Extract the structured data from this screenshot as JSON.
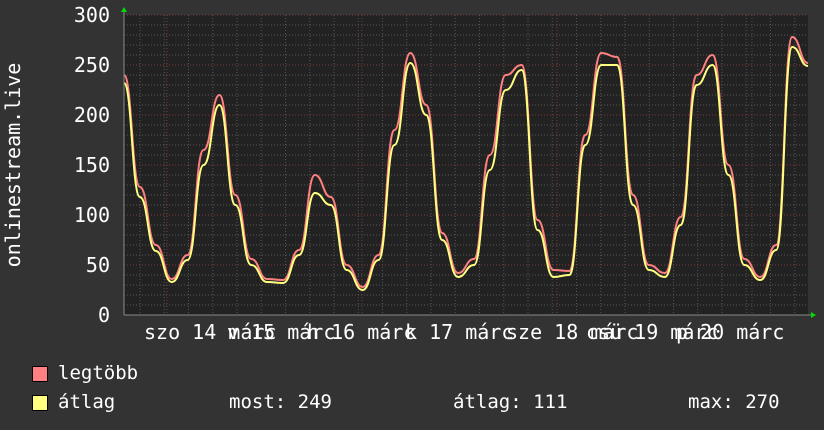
{
  "chart_data": {
    "type": "line",
    "ylabel": "onlinestream.live",
    "ylim": [
      0,
      300
    ],
    "yticks": [
      0,
      50,
      100,
      150,
      200,
      250,
      300
    ],
    "xtick_labels": [
      "szo 14 márc",
      "v 15 márc",
      "h 16 márc",
      "k 17 márc",
      "sze 18 márc",
      "csü 19 márc",
      "p 20 márc"
    ],
    "grid": true,
    "legend_position": "bottom-left",
    "series": [
      {
        "name": "legtöbb",
        "color": "#ff8080",
        "values": [
          240,
          128,
          70,
          36,
          60,
          165,
          220,
          120,
          56,
          36,
          35,
          65,
          140,
          118,
          50,
          28,
          60,
          185,
          262,
          210,
          82,
          42,
          56,
          160,
          240,
          250,
          95,
          45,
          44,
          180,
          262,
          258,
          120,
          50,
          42,
          98,
          240,
          260,
          150,
          56,
          38,
          70,
          278,
          252
        ]
      },
      {
        "name": "átlag",
        "color": "#ffff80",
        "values": [
          232,
          118,
          64,
          33,
          55,
          150,
          210,
          110,
          50,
          33,
          32,
          60,
          122,
          110,
          45,
          25,
          55,
          170,
          252,
          200,
          75,
          38,
          50,
          145,
          225,
          245,
          85,
          38,
          40,
          170,
          250,
          250,
          110,
          45,
          38,
          90,
          230,
          250,
          140,
          50,
          35,
          65,
          268,
          249
        ]
      }
    ],
    "legend": {
      "max_label": "legtöbb",
      "avg_label": "átlag",
      "most": "most: 249",
      "atlag": "átlag: 111",
      "max": "max: 270"
    }
  }
}
